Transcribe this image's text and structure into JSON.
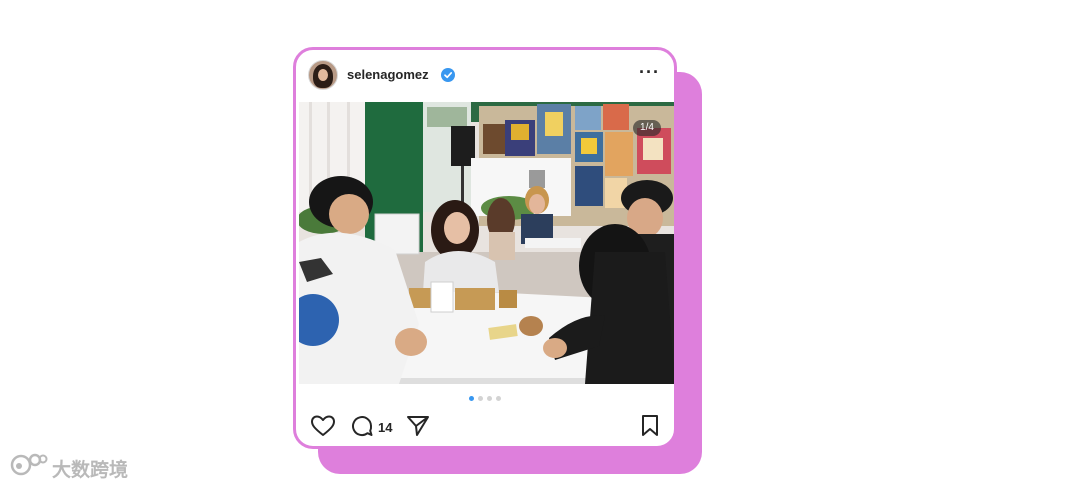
{
  "post": {
    "username": "selenagomez",
    "verified": true,
    "more_label": "···",
    "image_counter": "1/4",
    "carousel": {
      "total": 4,
      "active_index": 0
    },
    "comment_count": "14"
  },
  "icons": {
    "verified": "verified-badge-icon",
    "more": "more-options-icon",
    "like": "heart-icon",
    "comment": "comment-icon",
    "share": "paper-plane-icon",
    "save": "bookmark-icon"
  },
  "watermark": {
    "text": "大数跨境"
  },
  "colors": {
    "accent": "#de7fdc",
    "verified": "#3897f0",
    "active_dot": "#3897f0",
    "text": "#262626"
  }
}
